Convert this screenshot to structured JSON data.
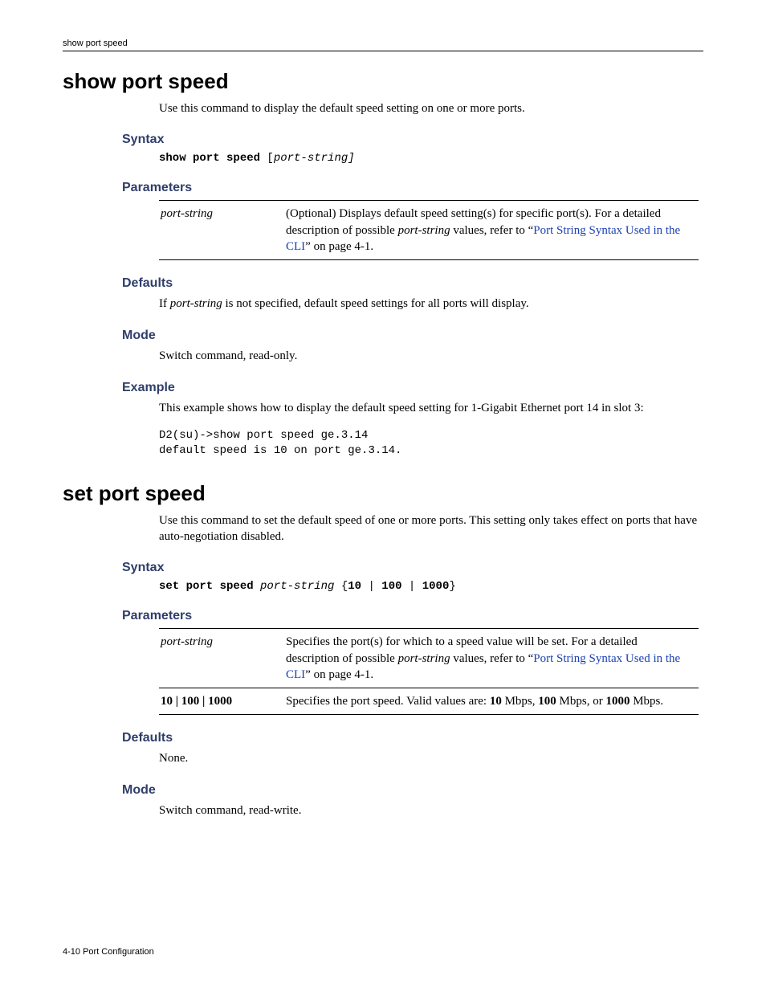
{
  "running_head": "show port speed",
  "footer": "4-10   Port Configuration",
  "cmd1": {
    "title": "show port speed",
    "intro": "Use this command to display the default speed setting on one or more ports.",
    "syntax_heading": "Syntax",
    "syntax_kw": "show port speed ",
    "syntax_rest_open": "[",
    "syntax_arg": "port-string]",
    "param_heading": "Parameters",
    "param_name": "port-string",
    "param_desc_pre": "(Optional) Displays default speed setting(s) for specific port(s). For a detailed description of possible ",
    "param_desc_ital": "port-string",
    "param_desc_mid": " values, refer to “",
    "param_link": "Port String Syntax Used in the CLI",
    "param_desc_post": "” on page 4-1.",
    "defaults_heading": "Defaults",
    "defaults_pre": "If ",
    "defaults_ital": "port-string",
    "defaults_post": " is not specified, default speed settings for all ports will display.",
    "mode_heading": "Mode",
    "mode_text": "Switch command, read-only.",
    "example_heading": "Example",
    "example_text": "This example shows how to display the default speed setting for 1-Gigabit Ethernet port 14 in slot 3:",
    "example_console": "D2(su)->show port speed ge.3.14\ndefault speed is 10 on port ge.3.14."
  },
  "cmd2": {
    "title": "set port speed",
    "intro": "Use this command to set the default speed of one or more ports. This setting only takes effect on ports that have auto-negotiation disabled.",
    "syntax_heading": "Syntax",
    "syntax_kw": "set port speed ",
    "syntax_arg": "port-string",
    "syntax_rest": " {",
    "syntax_opt1": "10",
    "syntax_sep1": " | ",
    "syntax_opt2": "100",
    "syntax_sep2": " | ",
    "syntax_opt3": "1000",
    "syntax_close": "}",
    "param_heading": "Parameters",
    "p1_name": "port-string",
    "p1_desc_pre": "Specifies the port(s) for which to a speed value will be set. For a detailed description of possible ",
    "p1_desc_ital": "port-string",
    "p1_desc_mid": " values, refer to “",
    "p1_link": "Port String Syntax Used in the CLI",
    "p1_desc_post": "” on page 4-1.",
    "p2_name": "10 | 100 | 1000",
    "p2_desc_pre": "Specifies the port speed. Valid values are: ",
    "p2_v1": "10",
    "p2_u1": " Mbps, ",
    "p2_v2": "100",
    "p2_u2": " Mbps, or ",
    "p2_v3": "1000",
    "p2_u3": " Mbps.",
    "defaults_heading": "Defaults",
    "defaults_text": "None.",
    "mode_heading": "Mode",
    "mode_text": "Switch command, read-write."
  }
}
